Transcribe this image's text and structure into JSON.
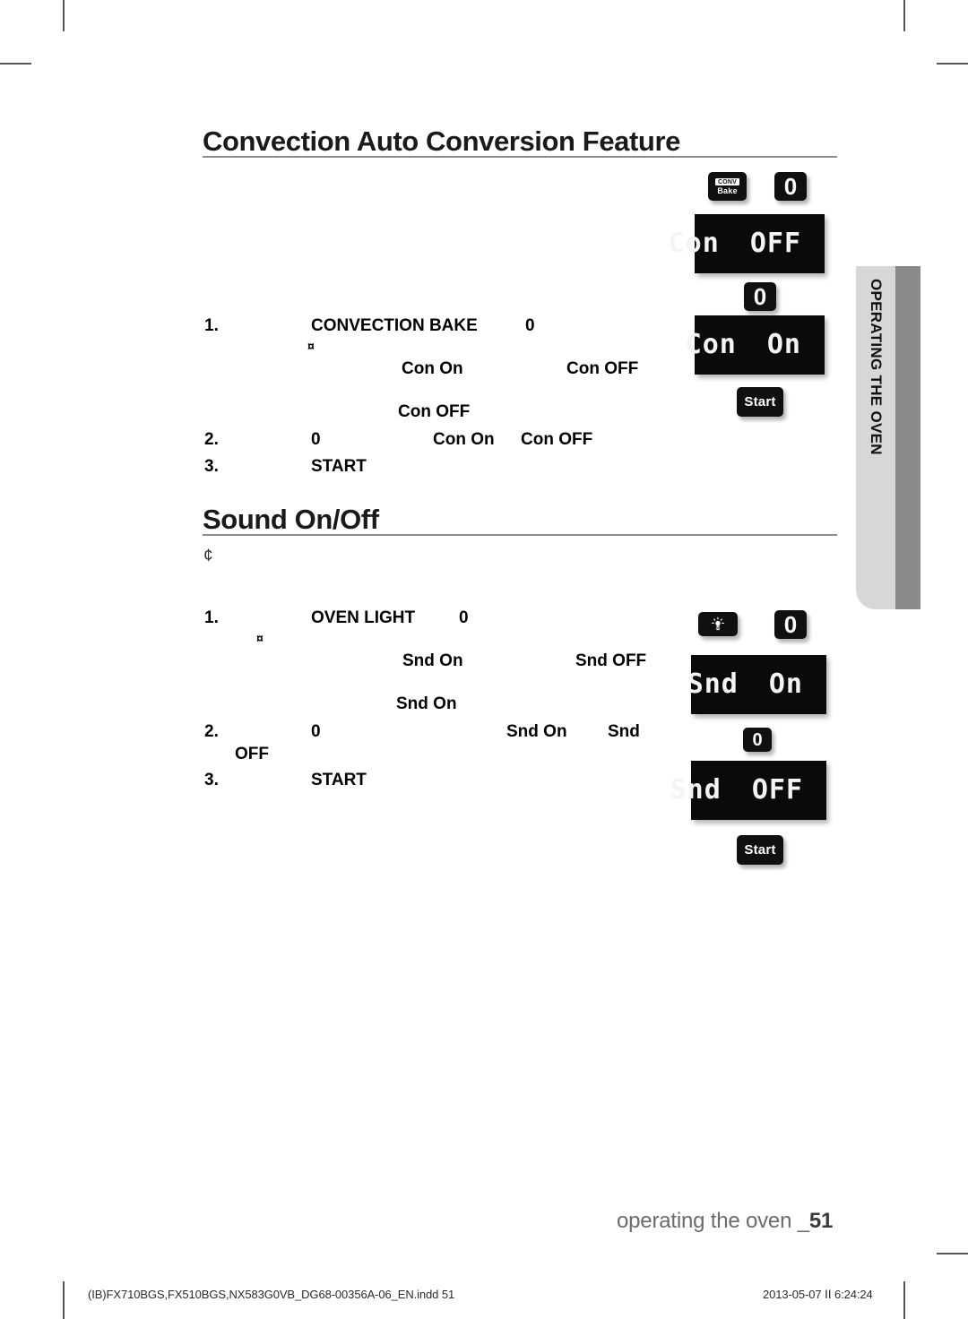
{
  "document": {
    "page_number_label": "operating the oven _",
    "page_number": "51"
  },
  "side_tab": {
    "label": "OPERATING THE OVEN"
  },
  "sections": [
    {
      "id": "convection-auto-conversion",
      "heading": "Convection Auto Conversion Feature",
      "lines": [
        {
          "id": "step1-number",
          "text": "1."
        },
        {
          "id": "step1-key",
          "text": "CONVECTION BAKE"
        },
        {
          "id": "step1-zero",
          "text": "0"
        },
        {
          "id": "step1-marker",
          "text": "¤"
        },
        {
          "id": "con-on-a",
          "text": "Con On"
        },
        {
          "id": "con-off-a",
          "text": "Con OFF"
        },
        {
          "id": "con-off-b",
          "text": "Con OFF"
        },
        {
          "id": "step2-number",
          "text": "2."
        },
        {
          "id": "step2-zero",
          "text": "0"
        },
        {
          "id": "con-on-b",
          "text": "Con On"
        },
        {
          "id": "con-off-c",
          "text": "Con OFF"
        },
        {
          "id": "step3-number",
          "text": "3."
        },
        {
          "id": "step3-key",
          "text": "START"
        }
      ]
    },
    {
      "id": "sound-on-off",
      "heading": "Sound On/Off",
      "note_marker": "¢",
      "lines": [
        {
          "id": "step1-number",
          "text": "1."
        },
        {
          "id": "step1-key",
          "text": "OVEN LIGHT"
        },
        {
          "id": "step1-zero",
          "text": "0"
        },
        {
          "id": "step1-marker",
          "text": "¤"
        },
        {
          "id": "snd-on-a",
          "text": "Snd On"
        },
        {
          "id": "snd-off-a",
          "text": "Snd OFF"
        },
        {
          "id": "snd-on-b",
          "text": "Snd On"
        },
        {
          "id": "step2-number",
          "text": "2."
        },
        {
          "id": "step2-zero",
          "text": "0"
        },
        {
          "id": "snd-on-c",
          "text": "Snd On"
        },
        {
          "id": "snd-partial",
          "text": "Snd"
        },
        {
          "id": "off-wrap",
          "text": "OFF"
        },
        {
          "id": "step3-number",
          "text": "3."
        },
        {
          "id": "step3-key",
          "text": "START"
        }
      ]
    }
  ],
  "control_panel": {
    "conv_bake_key": {
      "top_label": "CONV",
      "bottom_label": "Bake"
    },
    "zero_key": "0",
    "start_key": "Start",
    "displays": [
      {
        "id": "con-off-display",
        "left": "Con",
        "right": "OFF"
      },
      {
        "id": "con-on-display",
        "left": "Con",
        "right": "On"
      },
      {
        "id": "snd-on-display",
        "left": "Snd",
        "right": "On"
      },
      {
        "id": "snd-off-display",
        "left": "Snd",
        "right": "OFF"
      }
    ]
  },
  "imprint": {
    "file": "(IB)FX710BGS,FX510BGS,NX583G0VB_DG68-00356A-06_EN.indd   51",
    "timestamp": "2013-05-07   ⅠⅠ 6:24:24"
  },
  "colors": {
    "rule": "#8c8c8c",
    "tab_light": "#d7d7d7",
    "tab_dark": "#8a8a8a",
    "lcd_bg": "#0a0a0a",
    "footer_text": "#6b6b6b"
  }
}
